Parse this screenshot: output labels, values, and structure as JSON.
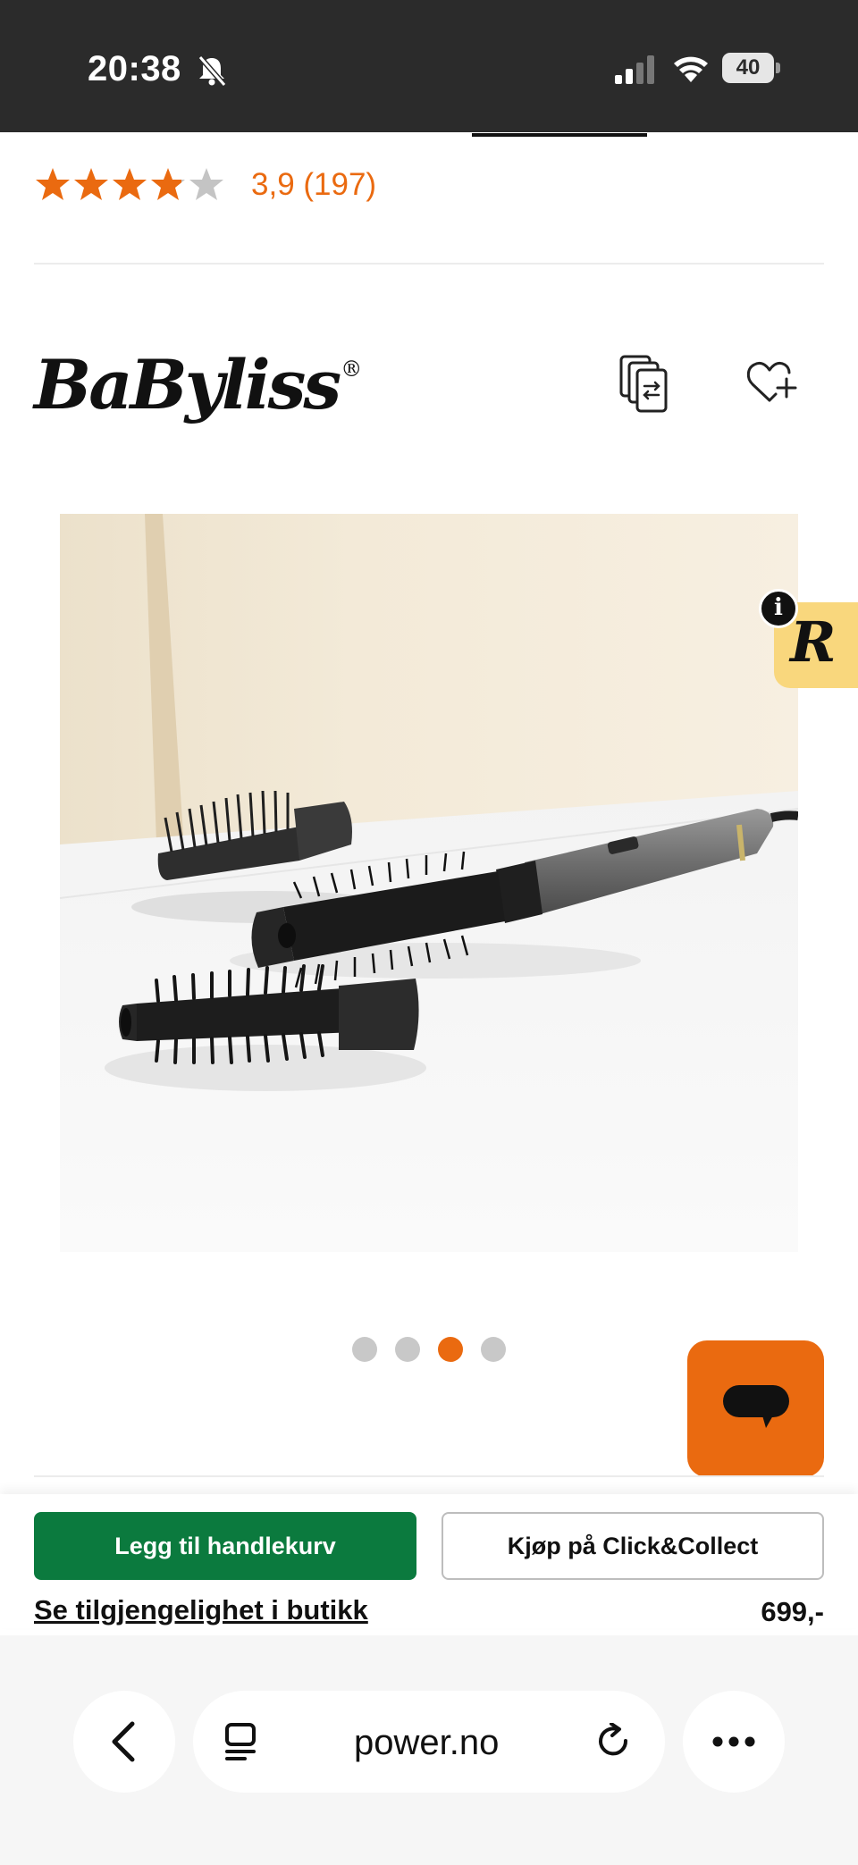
{
  "status_bar": {
    "time": "20:38",
    "battery": "40",
    "icons": [
      "bell-muted-icon",
      "cell-signal-icon",
      "wifi-icon",
      "battery-icon"
    ]
  },
  "product": {
    "rating_value": 3.9,
    "rating_max": 5,
    "rating_text": "3,9 (197)",
    "brand": "BaByliss",
    "brand_mark": "®",
    "price": "699,-"
  },
  "gallery": {
    "slide_count": 4,
    "active_slide": 3
  },
  "badges": {
    "info_label": "i",
    "r_label": "R"
  },
  "actions": {
    "add_to_cart": "Legg til handlekurv",
    "click_collect": "Kjøp på Click&Collect",
    "store_availability": "Se tilgjengelighet i butikk"
  },
  "browser": {
    "url": "power.no"
  },
  "colors": {
    "accent": "#ea6a10",
    "cart_button": "#0b7a3e",
    "status_bar": "#2b2b2b",
    "badge_yellow": "#f9d77d"
  }
}
